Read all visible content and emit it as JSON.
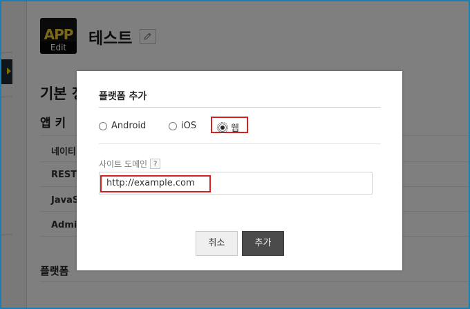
{
  "page": {
    "app_icon_text": "APP",
    "app_icon_edit": "Edit",
    "app_name": "테스트",
    "section_title": "기본 정",
    "app_keys_title": "앱 키",
    "key_rows": [
      "네이티",
      "REST A",
      "JavaSc",
      "Admin"
    ],
    "platform_title": "플랫폼"
  },
  "dialog": {
    "title": "플랫폼 추가",
    "platform_options": [
      {
        "label": "Android",
        "selected": false
      },
      {
        "label": "iOS",
        "selected": false
      },
      {
        "label": "웹",
        "selected": true
      }
    ],
    "site_domain_label": "사이트 도메인",
    "help_icon_glyph": "?",
    "site_domain_value": "http://example.com",
    "cancel_label": "취소",
    "add_label": "추가"
  },
  "colors": {
    "highlight": "#d81e1e",
    "primary_button": "#4b4b4b",
    "frame": "#1d7fb0"
  }
}
